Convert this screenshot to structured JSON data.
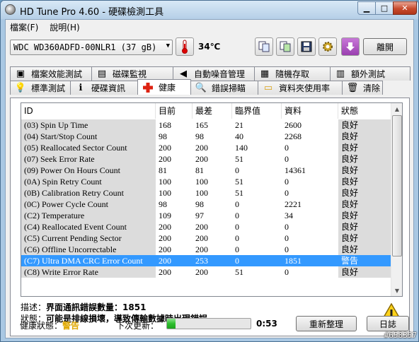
{
  "window": {
    "title": "HD Tune Pro 4.60 - 硬碟檢測工具"
  },
  "menu": [
    {
      "label": "檔案(F)"
    },
    {
      "label": "說明(H)"
    }
  ],
  "toolbar": {
    "drive": "WDC WD360ADFD-00NLR1 (37 gB)",
    "temperature": "34℃",
    "exit_label": "離開"
  },
  "tabs_top": [
    {
      "label": "檔案效能測試",
      "icon": "file-benchmark-icon"
    },
    {
      "label": "磁碟監視",
      "icon": "disk-monitor-icon"
    },
    {
      "label": "自動噪音管理",
      "icon": "speaker-icon"
    },
    {
      "label": "隨機存取",
      "icon": "random-access-icon"
    },
    {
      "label": "額外測試",
      "icon": "extra-tests-icon"
    }
  ],
  "tabs_bottom": [
    {
      "label": "標準測試",
      "icon": "lightbulb-icon"
    },
    {
      "label": "硬碟資訊",
      "icon": "info-icon"
    },
    {
      "label": "健康",
      "icon": "health-cross-icon",
      "active": true
    },
    {
      "label": "錯誤掃瞄",
      "icon": "magnifier-icon"
    },
    {
      "label": "資料夾使用率",
      "icon": "folder-icon"
    },
    {
      "label": "清除",
      "icon": "trash-icon"
    }
  ],
  "table": {
    "headers": [
      "ID",
      "目前",
      "最差",
      "臨界值",
      "資料",
      "狀態"
    ],
    "rows": [
      [
        "(03) Spin Up Time",
        "168",
        "165",
        "21",
        "2600",
        "良好"
      ],
      [
        "(04) Start/Stop Count",
        "98",
        "98",
        "40",
        "2268",
        "良好"
      ],
      [
        "(05) Reallocated Sector Count",
        "200",
        "200",
        "140",
        "0",
        "良好"
      ],
      [
        "(07) Seek Error Rate",
        "200",
        "200",
        "51",
        "0",
        "良好"
      ],
      [
        "(09) Power On Hours Count",
        "81",
        "81",
        "0",
        "14361",
        "良好"
      ],
      [
        "(0A) Spin Retry Count",
        "100",
        "100",
        "51",
        "0",
        "良好"
      ],
      [
        "(0B) Calibration Retry Count",
        "100",
        "100",
        "51",
        "0",
        "良好"
      ],
      [
        "(0C) Power Cycle Count",
        "98",
        "98",
        "0",
        "2221",
        "良好"
      ],
      [
        "(C2) Temperature",
        "109",
        "97",
        "0",
        "34",
        "良好"
      ],
      [
        "(C4) Reallocated Event Count",
        "200",
        "200",
        "0",
        "0",
        "良好"
      ],
      [
        "(C5) Current Pending Sector",
        "200",
        "200",
        "0",
        "0",
        "良好"
      ],
      [
        "(C6) Offline Uncorrectable",
        "200",
        "200",
        "0",
        "0",
        "良好"
      ],
      [
        "(C7) Ultra DMA CRC Error Count",
        "200",
        "253",
        "0",
        "1851",
        "警告"
      ],
      [
        "(C8) Write Error Rate",
        "200",
        "200",
        "51",
        "0",
        "良好"
      ]
    ],
    "selected_row": 12
  },
  "description": {
    "line1_label": "描述：",
    "line1_value": "界面通訊錯誤數量：1851",
    "line2_label": "狀態：",
    "line2_value": "可能是排線損壞，導致傳輸數據時出現錯誤。"
  },
  "status_bar": {
    "health_label": "健康狀態：",
    "health_value": "警告",
    "next_update_label": "下次更新：",
    "progress_fraction": 0.1,
    "timer": "0:53",
    "refresh_label": "重新整理",
    "log_label": "日誌"
  },
  "watermark": "#658357",
  "colors": {
    "selected": "#3399ff",
    "warning": "#e0a800",
    "progress": "#2fbf2f"
  }
}
